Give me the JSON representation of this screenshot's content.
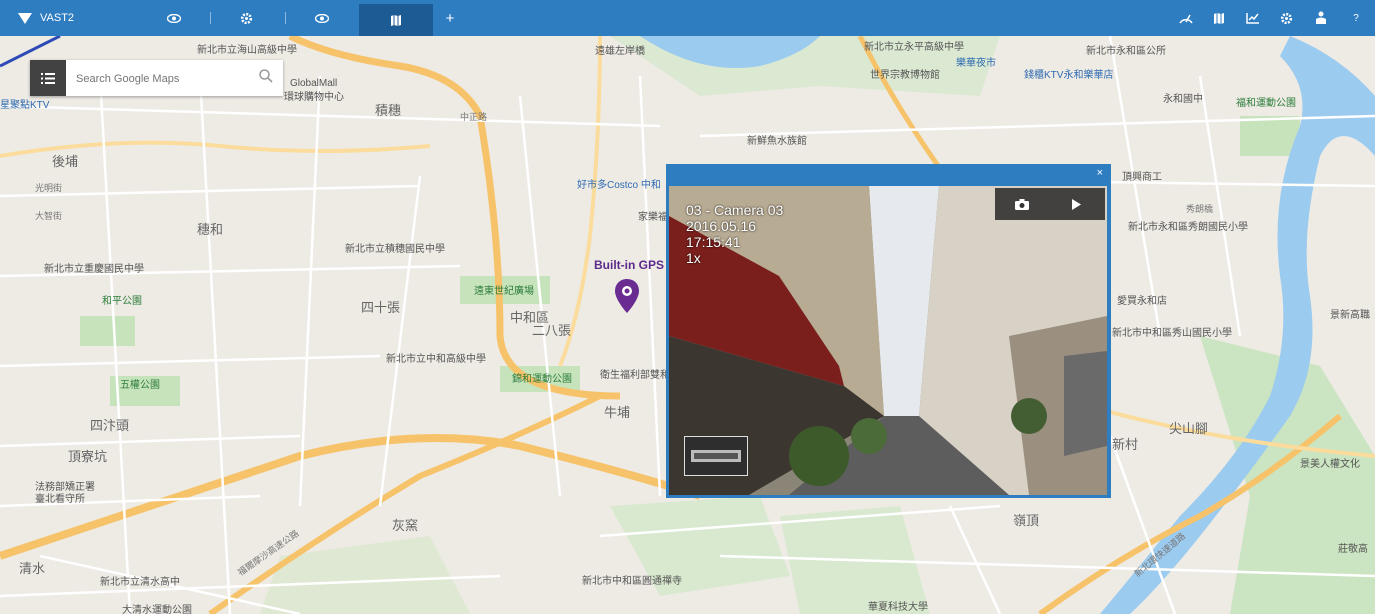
{
  "topbar": {
    "app_name": "VAST2",
    "add_tab": "+",
    "help": "?",
    "accent": "#2f7dc1",
    "active_tab_color": "#1c5b93",
    "icons": [
      "eye-icon",
      "gear-icon",
      "eye-icon",
      "map-icon",
      "plus-icon",
      "dashboard-icon",
      "map-icon",
      "chart-icon",
      "gear-icon",
      "user-icon",
      "help-icon"
    ]
  },
  "search": {
    "placeholder": "Search Google Maps"
  },
  "gps": {
    "label": "Built-in GPS",
    "color": "#6a2c91"
  },
  "popup": {
    "close": "×",
    "osd": {
      "camera": "03 - Camera 03",
      "date": "2016.05.16",
      "time": "17:15:41",
      "speed": "1x"
    }
  },
  "map_labels": [
    "新北市立海山高級中學",
    "遠雄左岸橋",
    "新北市立永平高級中學",
    "世界宗教博物館",
    "樂華夜市",
    "錢櫃KTV永和樂華店",
    "新北市永和區公所",
    "永和國中",
    "福和運動公園",
    "GlobalMall",
    "環球購物中心",
    "積穗",
    "新鮮魚水族館",
    "好市多Costco 中和",
    "家樂福",
    "後埔",
    "光明街",
    "大智街",
    "穗和",
    "新北市立積穗國民中學",
    "新北市立重慶國民中學",
    "和平公園",
    "四十張",
    "遠東世紀廣場",
    "中和區",
    "二八張",
    "新北市立中和高級中學",
    "錦和運動公園",
    "衛生福利部雙和醫院",
    "五權公園",
    "四汴頭",
    "頂寮坑",
    "牛埔",
    "法務部矯正署",
    "臺北看守所",
    "灰窯",
    "清水",
    "新北市立清水高中",
    "大清水運動公園",
    "新北市中和區圓通禪寺",
    "華夏科技大學",
    "嶺頂",
    "新北市永和區秀朗國民小學",
    "愛買永和店",
    "新北市中和區秀山國民小學",
    "尖山腳",
    "新村",
    "景美人權文化",
    "莊敬高",
    "景新高職",
    "福爾摩沙高速公路",
    "新北環快速道路",
    "星聚點KTV",
    "中正路",
    "頂興商工",
    "秀朗橋",
    "新北市立中和高級中學"
  ]
}
